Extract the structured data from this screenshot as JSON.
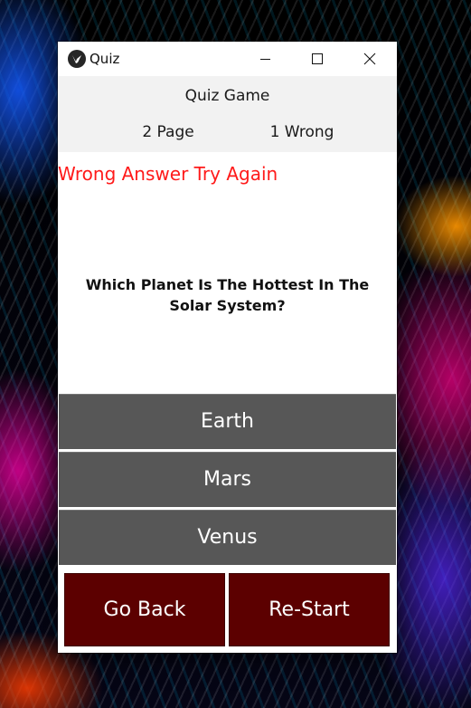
{
  "window": {
    "title": "Quiz"
  },
  "header": {
    "game_title": "Quiz Game",
    "page_label": "2 Page",
    "wrong_label": "1 Wrong"
  },
  "feedback": {
    "message": "Wrong Answer Try Again",
    "color": "#ff1a1a"
  },
  "question": {
    "text": "Which Planet Is The Hottest In The Solar System?"
  },
  "answers": [
    {
      "label": "Earth"
    },
    {
      "label": "Mars"
    },
    {
      "label": "Venus"
    }
  ],
  "footer": {
    "back_label": "Go Back",
    "restart_label": "Re-Start",
    "button_color": "#5c0000"
  },
  "icons": {
    "app": "kivy-logo-icon",
    "minimize": "minimize-icon",
    "maximize": "maximize-icon",
    "close": "close-icon"
  },
  "colors": {
    "answer_button": "#575757",
    "header_background": "#f2f2f2"
  }
}
